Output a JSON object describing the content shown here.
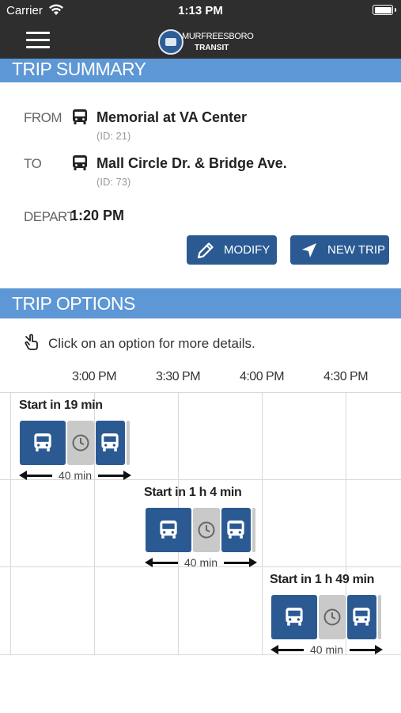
{
  "status_bar": {
    "carrier": "Carrier",
    "time": "1:13 PM"
  },
  "header": {
    "logo_line1": "MURFREESBORO",
    "logo_line2": "TRANSIT",
    "menu_icon": "hamburger-menu-icon"
  },
  "trip_summary": {
    "section_title": "TRIP SUMMARY",
    "from_label": "FROM",
    "from_name": "Memorial at VA Center",
    "from_id": "(ID: 21)",
    "to_label": "TO",
    "to_name": "Mall Circle Dr. & Bridge Ave.",
    "to_id": "(ID: 73)",
    "depart_label": "DEPART",
    "depart_time": "1:20 PM",
    "modify_label": "MODIFY",
    "new_trip_label": "NEW TRIP"
  },
  "trip_options": {
    "section_title": "TRIP OPTIONS",
    "hint": "Click on an option for more details.",
    "timeline": [
      "3:00 PM",
      "3:30 PM",
      "4:00 PM",
      "4:30 PM"
    ],
    "options": [
      {
        "title": "Start in 19 min",
        "duration": "40 min"
      },
      {
        "title": "Start in 1 h 4 min",
        "duration": "40 min"
      },
      {
        "title": "Start in 1 h 49 min",
        "duration": "40 min"
      }
    ]
  },
  "colors": {
    "nav": "#2e2e2e",
    "section": "#5d97d5",
    "accent": "#2b5a93",
    "wait": "#c9c9c9"
  }
}
